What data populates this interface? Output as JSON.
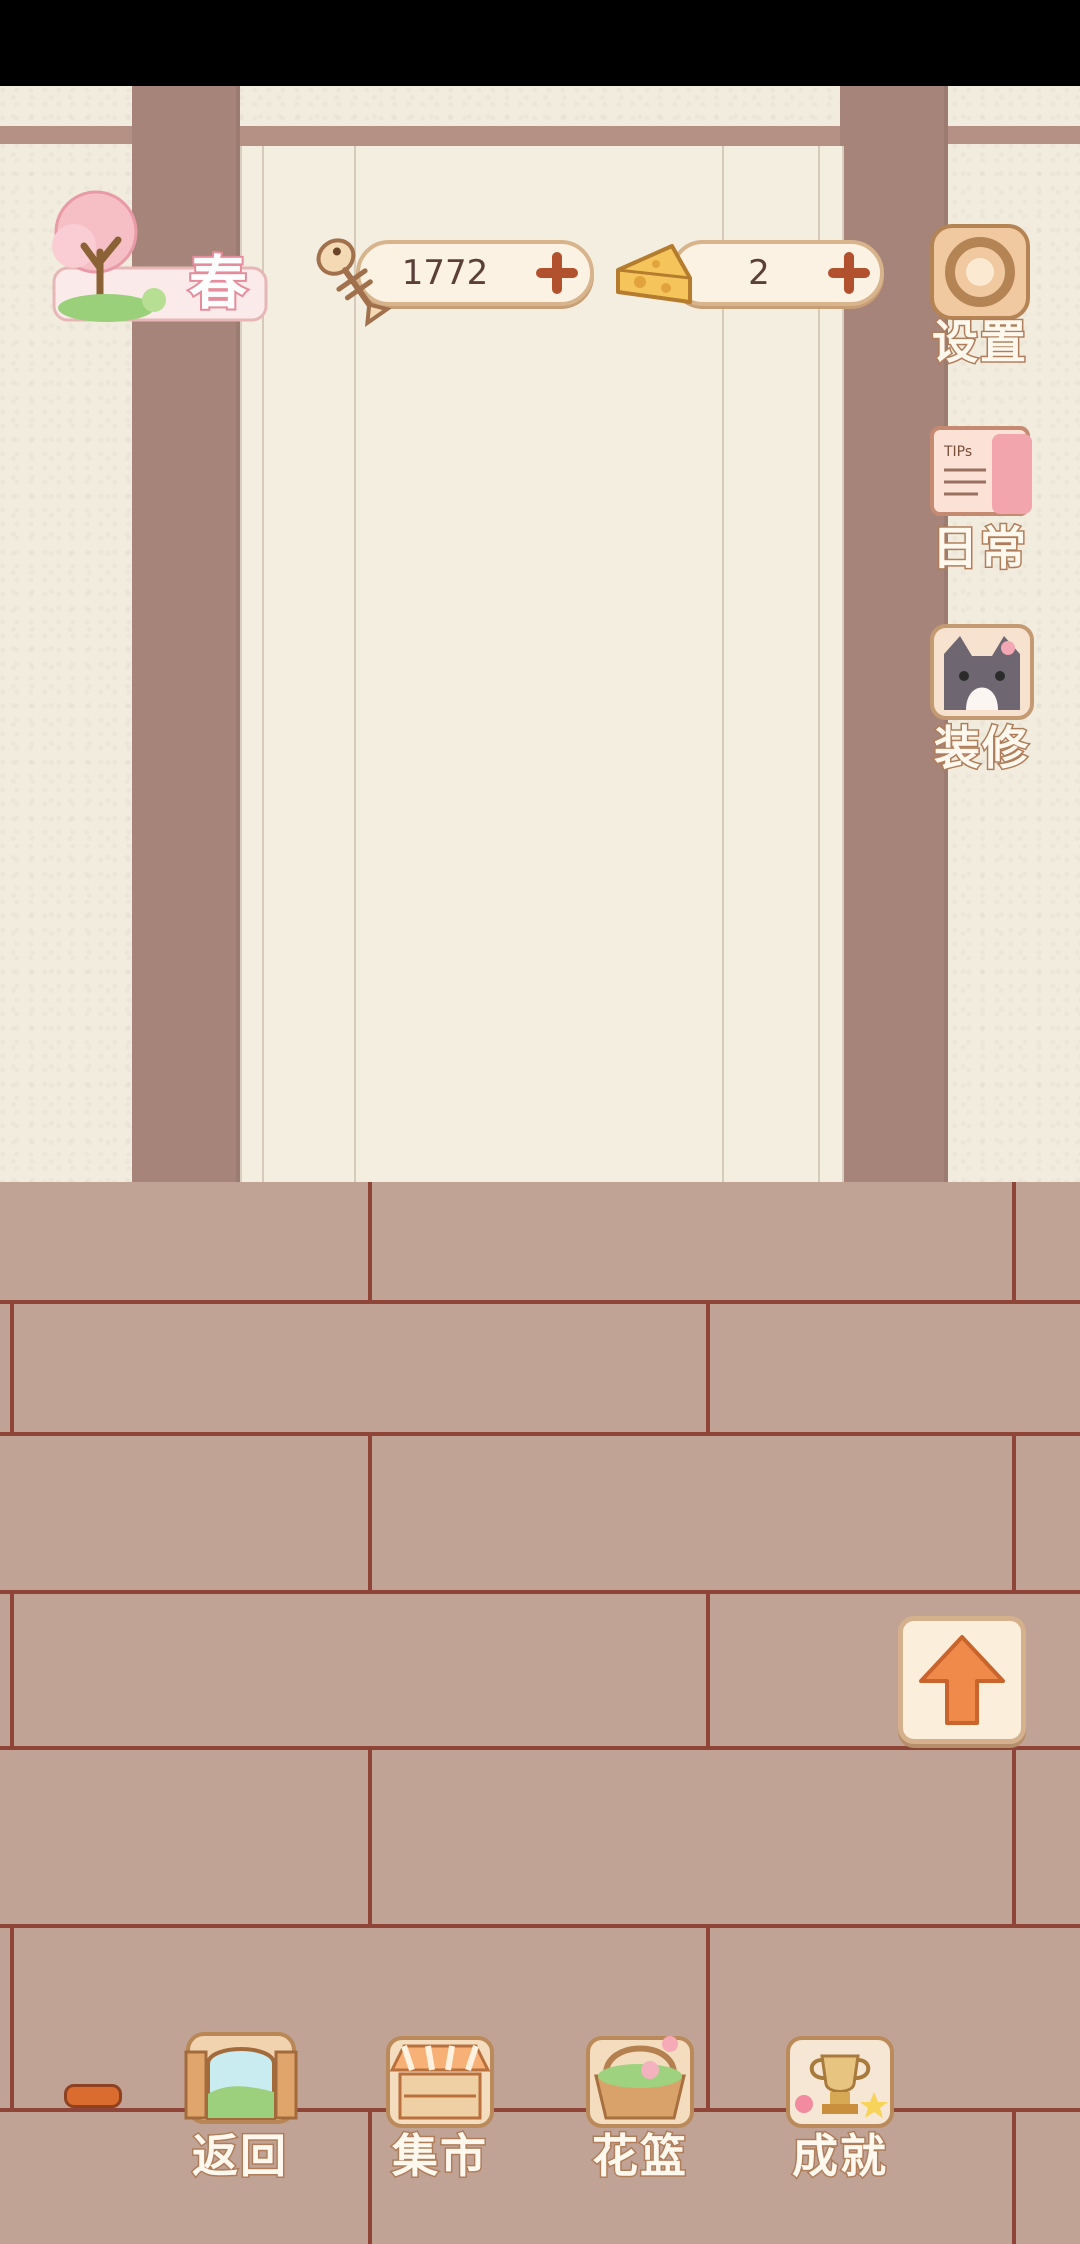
{
  "season": {
    "label": "春"
  },
  "resources": {
    "fish": {
      "value": "1772",
      "icon": "fish-bone-icon"
    },
    "cheese": {
      "value": "2",
      "icon": "cheese-icon"
    }
  },
  "side_menu": [
    {
      "label": "设置",
      "icon": "gear-icon"
    },
    {
      "label": "日常",
      "icon": "tips-notebook-icon"
    },
    {
      "label": "装修",
      "icon": "cat-face-icon"
    }
  ],
  "bottom_menu": [
    {
      "label": "返回",
      "icon": "window-door-icon"
    },
    {
      "label": "集市",
      "icon": "market-stall-icon"
    },
    {
      "label": "花篮",
      "icon": "flower-basket-icon"
    },
    {
      "label": "成就",
      "icon": "trophy-icon"
    }
  ],
  "colors": {
    "wall": "#f1ecdd",
    "pillar": "#a68479",
    "floor": "#c1a396",
    "floor_lines": "#8f4438",
    "accent_orange": "#f08a4b"
  }
}
